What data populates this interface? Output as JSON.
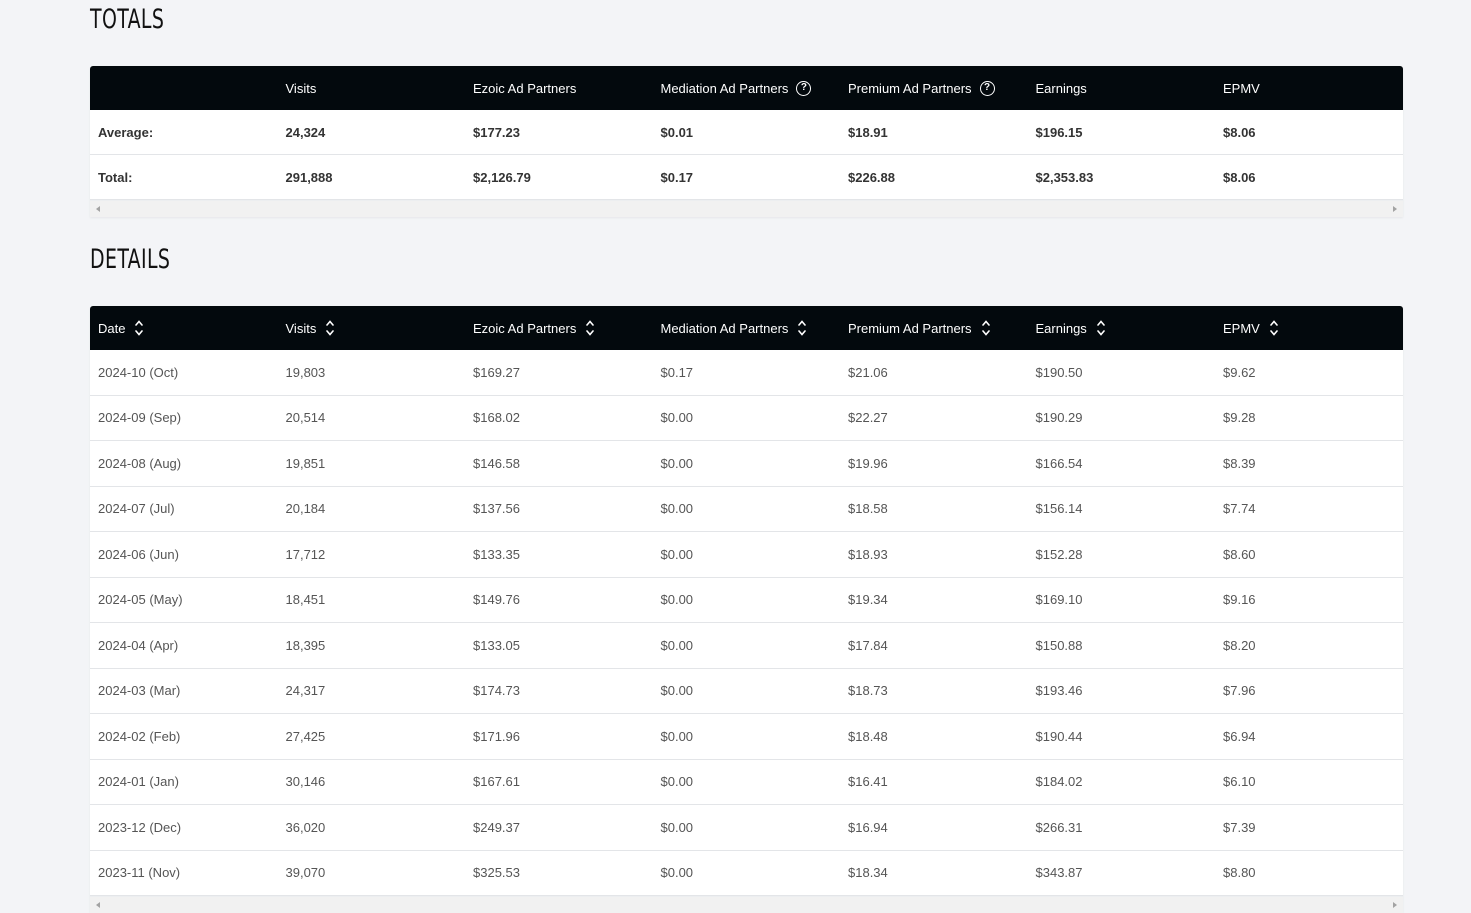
{
  "totals": {
    "title": "TOTALS",
    "headers": [
      "",
      "Visits",
      "Ezoic Ad Partners",
      "Mediation Ad Partners",
      "Premium Ad Partners",
      "Earnings",
      "EPMV"
    ],
    "rows": [
      [
        "Average:",
        "24,324",
        "$177.23",
        "$0.01",
        "$18.91",
        "$196.15",
        "$8.06"
      ],
      [
        "Total:",
        "291,888",
        "$2,126.79",
        "$0.17",
        "$226.88",
        "$2,353.83",
        "$8.06"
      ]
    ]
  },
  "details": {
    "title": "DETAILS",
    "headers": [
      "Date",
      "Visits",
      "Ezoic Ad Partners",
      "Mediation Ad Partners",
      "Premium Ad Partners",
      "Earnings",
      "EPMV"
    ],
    "rows": [
      [
        "2024-10 (Oct)",
        "19,803",
        "$169.27",
        "$0.17",
        "$21.06",
        "$190.50",
        "$9.62"
      ],
      [
        "2024-09 (Sep)",
        "20,514",
        "$168.02",
        "$0.00",
        "$22.27",
        "$190.29",
        "$9.28"
      ],
      [
        "2024-08 (Aug)",
        "19,851",
        "$146.58",
        "$0.00",
        "$19.96",
        "$166.54",
        "$8.39"
      ],
      [
        "2024-07 (Jul)",
        "20,184",
        "$137.56",
        "$0.00",
        "$18.58",
        "$156.14",
        "$7.74"
      ],
      [
        "2024-06 (Jun)",
        "17,712",
        "$133.35",
        "$0.00",
        "$18.93",
        "$152.28",
        "$8.60"
      ],
      [
        "2024-05 (May)",
        "18,451",
        "$149.76",
        "$0.00",
        "$19.34",
        "$169.10",
        "$9.16"
      ],
      [
        "2024-04 (Apr)",
        "18,395",
        "$133.05",
        "$0.00",
        "$17.84",
        "$150.88",
        "$8.20"
      ],
      [
        "2024-03 (Mar)",
        "24,317",
        "$174.73",
        "$0.00",
        "$18.73",
        "$193.46",
        "$7.96"
      ],
      [
        "2024-02 (Feb)",
        "27,425",
        "$171.96",
        "$0.00",
        "$18.48",
        "$190.44",
        "$6.94"
      ],
      [
        "2024-01 (Jan)",
        "30,146",
        "$167.61",
        "$0.00",
        "$16.41",
        "$184.02",
        "$6.10"
      ],
      [
        "2023-12 (Dec)",
        "36,020",
        "$249.37",
        "$0.00",
        "$16.94",
        "$266.31",
        "$7.39"
      ],
      [
        "2023-11 (Nov)",
        "39,070",
        "$325.53",
        "$0.00",
        "$18.34",
        "$343.87",
        "$8.80"
      ]
    ]
  },
  "icons": {
    "help": "question-circle-icon",
    "sort": "sort-icon"
  },
  "colors": {
    "header_bg": "#03090d",
    "page_bg": "#f3f4f7"
  }
}
